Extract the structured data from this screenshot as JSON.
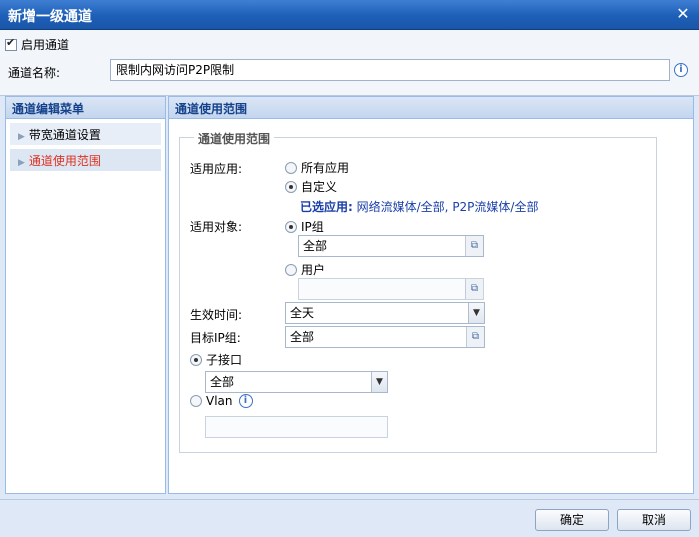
{
  "window": {
    "title": "新增一级通道",
    "close_label": "✕"
  },
  "enable_channel": {
    "label": "启用通道",
    "checked": true
  },
  "channel_name": {
    "label": "通道名称:",
    "value": "限制内网访问P2P限制"
  },
  "left_panel": {
    "title": "通道编辑菜单",
    "items": [
      {
        "label": "带宽通道设置",
        "active": false
      },
      {
        "label": "通道使用范围",
        "active": true
      }
    ]
  },
  "right_panel": {
    "title": "通道使用范围",
    "fieldset_legend": "通道使用范围",
    "applicable_app": {
      "label": "适用应用:",
      "options": [
        "所有应用",
        "自定义"
      ],
      "selected": "自定义",
      "selected_apps_label": "已选应用:",
      "selected_apps_value": "网络流媒体/全部, P2P流媒体/全部"
    },
    "applicable_object": {
      "label": "适用对象:",
      "ip_group_option": "IP组",
      "ip_group_value": "全部",
      "user_option": "用户",
      "user_value": "",
      "selected": "IP组"
    },
    "effective_time": {
      "label": "生效时间:",
      "value": "全天"
    },
    "target_ip_group": {
      "label": "目标IP组:",
      "value": "全部"
    },
    "sub_interface": {
      "label": "子接口",
      "value": "全部",
      "selected": true
    },
    "vlan": {
      "label": "Vlan",
      "value": "",
      "selected": false
    }
  },
  "buttons": {
    "ok": "确定",
    "cancel": "取消"
  },
  "icons": {
    "info": "i",
    "picker": "⧉",
    "dropdown": "▼",
    "arrow": "▶"
  },
  "colors": {
    "title_bar": "#1d5fb8",
    "active_menu_text": "#e0301e",
    "selected_apps_text": "#1a3fa8"
  }
}
